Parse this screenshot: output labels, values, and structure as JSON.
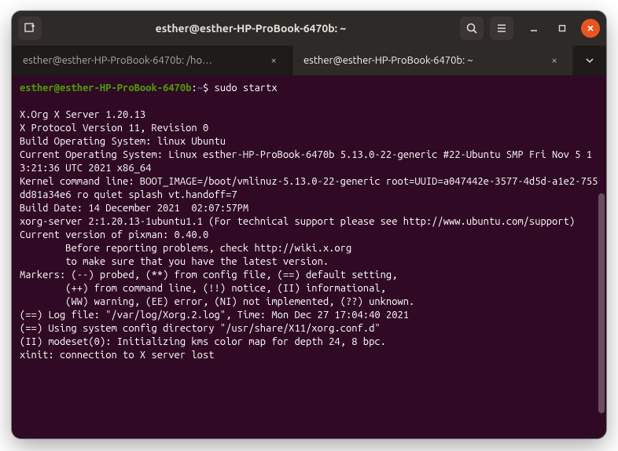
{
  "window": {
    "title": "esther@esther-HP-ProBook-6470b: ~"
  },
  "tabs": [
    {
      "label": "esther@esther-HP-ProBook-6470b: /ho…",
      "active": false
    },
    {
      "label": "esther@esther-HP-ProBook-6470b: ~",
      "active": true
    }
  ],
  "prompt": {
    "user_host": "esther@esther-HP-ProBook-6470b",
    "sep1": ":",
    "path": "~",
    "sep2": "$ ",
    "command": "sudo startx"
  },
  "output": "\nX.Org X Server 1.20.13\nX Protocol Version 11, Revision 0\nBuild Operating System: linux Ubuntu\nCurrent Operating System: Linux esther-HP-ProBook-6470b 5.13.0-22-generic #22-Ubuntu SMP Fri Nov 5 13:21:36 UTC 2021 x86_64\nKernel command line: BOOT_IMAGE=/boot/vmlinuz-5.13.0-22-generic root=UUID=a047442e-3577-4d5d-a1e2-755dd81a34e6 ro quiet splash vt.handoff=7\nBuild Date: 14 December 2021  02:07:57PM\nxorg-server 2:1.20.13-1ubuntu1.1 (For technical support please see http://www.ubuntu.com/support)\nCurrent version of pixman: 0.40.0\n        Before reporting problems, check http://wiki.x.org\n        to make sure that you have the latest version.\nMarkers: (--) probed, (**) from config file, (==) default setting,\n        (++) from command line, (!!) notice, (II) informational,\n        (WW) warning, (EE) error, (NI) not implemented, (??) unknown.\n(==) Log file: \"/var/log/Xorg.2.log\", Time: Mon Dec 27 17:04:40 2021\n(==) Using system config directory \"/usr/share/X11/xorg.conf.d\"\n(II) modeset(0): Initializing kms color map for depth 24, 8 bpc.\nxinit: connection to X server lost"
}
